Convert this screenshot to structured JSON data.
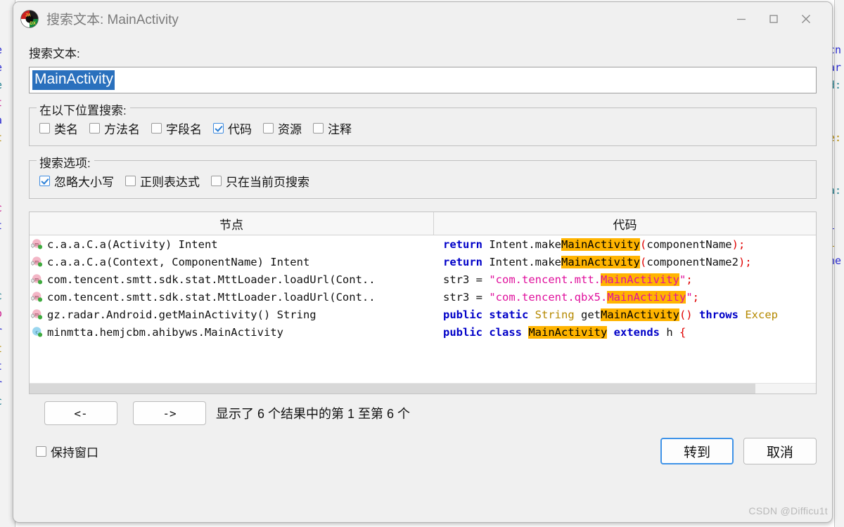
{
  "window": {
    "title": "搜索文本: MainActivity",
    "app_icon": "jadx-logo-icon",
    "minimize_label": "—",
    "maximize_label": "□",
    "close_label": "✕"
  },
  "search": {
    "label": "搜索文本:",
    "value": "MainActivity",
    "placeholder": ""
  },
  "where_group": {
    "title": "在以下位置搜索:",
    "options": [
      {
        "label": "类名",
        "checked": false
      },
      {
        "label": "方法名",
        "checked": false
      },
      {
        "label": "字段名",
        "checked": false
      },
      {
        "label": "代码",
        "checked": true
      },
      {
        "label": "资源",
        "checked": false
      },
      {
        "label": "注释",
        "checked": false
      }
    ]
  },
  "options_group": {
    "title": "搜索选项:",
    "options": [
      {
        "label": "忽略大小写",
        "checked": true
      },
      {
        "label": "正则表达式",
        "checked": false
      },
      {
        "label": "只在当前页搜索",
        "checked": false
      }
    ]
  },
  "results_table": {
    "columns": [
      "节点",
      "代码"
    ],
    "rows": [
      {
        "icon": "method-icon",
        "node": "c.a.a.C.a(Activity) Intent",
        "code_tokens": [
          {
            "t": "return",
            "c": "kw"
          },
          {
            "t": " Intent.make",
            "c": "pl"
          },
          {
            "t": "MainActivity",
            "c": "hl"
          },
          {
            "t": "(",
            "c": "pun"
          },
          {
            "t": "componentName",
            "c": "pl"
          },
          {
            "t": ")",
            "c": "pun"
          },
          {
            "t": ";",
            "c": "pun"
          }
        ]
      },
      {
        "icon": "method-icon",
        "node": "c.a.a.C.a(Context, ComponentName) Intent",
        "code_tokens": [
          {
            "t": "return",
            "c": "kw"
          },
          {
            "t": " Intent.make",
            "c": "pl"
          },
          {
            "t": "MainActivity",
            "c": "hl"
          },
          {
            "t": "(",
            "c": "pun"
          },
          {
            "t": "componentName2",
            "c": "pl"
          },
          {
            "t": ")",
            "c": "pun"
          },
          {
            "t": ";",
            "c": "pun"
          }
        ]
      },
      {
        "icon": "method-icon",
        "node": "com.tencent.smtt.sdk.stat.MttLoader.loadUrl(Cont..",
        "code_tokens": [
          {
            "t": "str3 ",
            "c": "pl"
          },
          {
            "t": "= ",
            "c": "pl"
          },
          {
            "t": "\"com.tencent.mtt.",
            "c": "str"
          },
          {
            "t": "MainActivity",
            "c": "hlstr"
          },
          {
            "t": "\"",
            "c": "str"
          },
          {
            "t": ";",
            "c": "pun"
          }
        ]
      },
      {
        "icon": "method-icon",
        "node": "com.tencent.smtt.sdk.stat.MttLoader.loadUrl(Cont..",
        "code_tokens": [
          {
            "t": "str3 ",
            "c": "pl"
          },
          {
            "t": "= ",
            "c": "pl"
          },
          {
            "t": "\"com.tencent.qbx5.",
            "c": "str"
          },
          {
            "t": "MainActivity",
            "c": "hlstr"
          },
          {
            "t": "\"",
            "c": "str"
          },
          {
            "t": ";",
            "c": "pun"
          }
        ]
      },
      {
        "icon": "method-icon",
        "node": "gz.radar.Android.getMainActivity() String",
        "code_tokens": [
          {
            "t": "public static ",
            "c": "kw"
          },
          {
            "t": "String",
            "c": "type"
          },
          {
            "t": " get",
            "c": "pl"
          },
          {
            "t": "MainActivity",
            "c": "hl"
          },
          {
            "t": "()",
            "c": "pun"
          },
          {
            "t": " ",
            "c": "pl"
          },
          {
            "t": "throws",
            "c": "kw"
          },
          {
            "t": " ",
            "c": "pl"
          },
          {
            "t": "Excep",
            "c": "type"
          }
        ]
      },
      {
        "icon": "class-icon",
        "node": "minmtta.hemjcbm.ahibyws.MainActivity",
        "code_tokens": [
          {
            "t": "public class ",
            "c": "kw"
          },
          {
            "t": "MainActivity",
            "c": "hl"
          },
          {
            "t": " ",
            "c": "pl"
          },
          {
            "t": "extends",
            "c": "kw"
          },
          {
            "t": " h ",
            "c": "pl"
          },
          {
            "t": "{",
            "c": "pun"
          }
        ]
      }
    ]
  },
  "navigation": {
    "prev_label": "<-",
    "next_label": "->",
    "status": "显示了 6 个结果中的第 1 至第 6 个"
  },
  "footer": {
    "keep_open_label": "保持窗口",
    "keep_open_checked": false,
    "goto_label": "转到",
    "cancel_label": "取消"
  },
  "watermark": "CSDN @Difficu1t",
  "colors": {
    "selection": "#2a70bd",
    "highlight": "#ffb400",
    "keyword": "#0000c8",
    "string": "#e0119d",
    "type": "#b58900",
    "punct": "#e00000",
    "accent": "#3f93e8"
  },
  "background_code": {
    "left": [
      "e",
      "e",
      "e",
      "t",
      "a",
      "t",
      "",
      "",
      "",
      "c",
      "t",
      "",
      "",
      "",
      "c",
      "o",
      "r",
      "t",
      "t",
      "r",
      "c"
    ],
    "right": [
      "cn",
      "ar",
      "d:",
      "",
      "",
      "e:",
      "",
      "",
      "a:",
      "",
      "i",
      "i",
      "ne"
    ]
  }
}
